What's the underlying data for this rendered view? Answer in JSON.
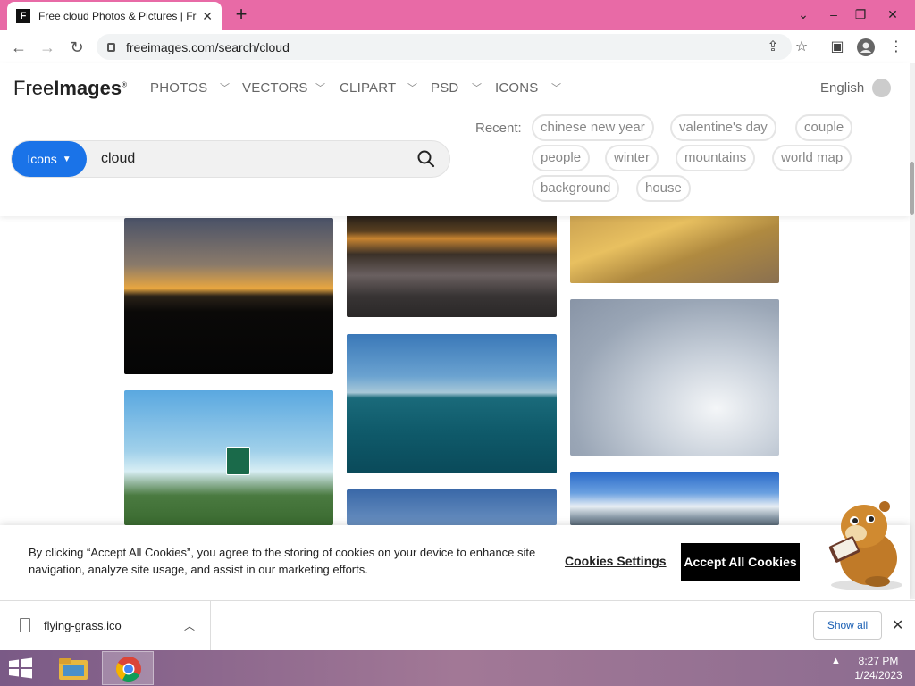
{
  "browser": {
    "tab_title": "Free cloud Photos & Pictures | Fr",
    "tab_favicon": "F",
    "url": "freeimages.com/search/cloud"
  },
  "site": {
    "logo_light": "Free",
    "logo_bold": "Images",
    "nav": [
      "PHOTOS",
      "VECTORS",
      "CLIPART",
      "PSD",
      "ICONS"
    ],
    "language": "English",
    "search": {
      "type_label": "Icons",
      "query": "cloud"
    },
    "recent_label": "Recent:",
    "recent": [
      "chinese new year",
      "valentine's day",
      "couple",
      "people",
      "winter",
      "mountains",
      "world map",
      "background",
      "house"
    ]
  },
  "cookie": {
    "text": "By clicking “Accept All Cookies”, you agree to the storing of cookies on your device to enhance site navigation, analyze site usage, and assist in our marketing efforts.",
    "settings_label": "Cookies Settings",
    "accept_label": "Accept All Cookies"
  },
  "download": {
    "filename": "flying-grass.ico",
    "show_all": "Show all"
  },
  "taskbar": {
    "time": "8:27 PM",
    "date": "1/24/2023"
  }
}
